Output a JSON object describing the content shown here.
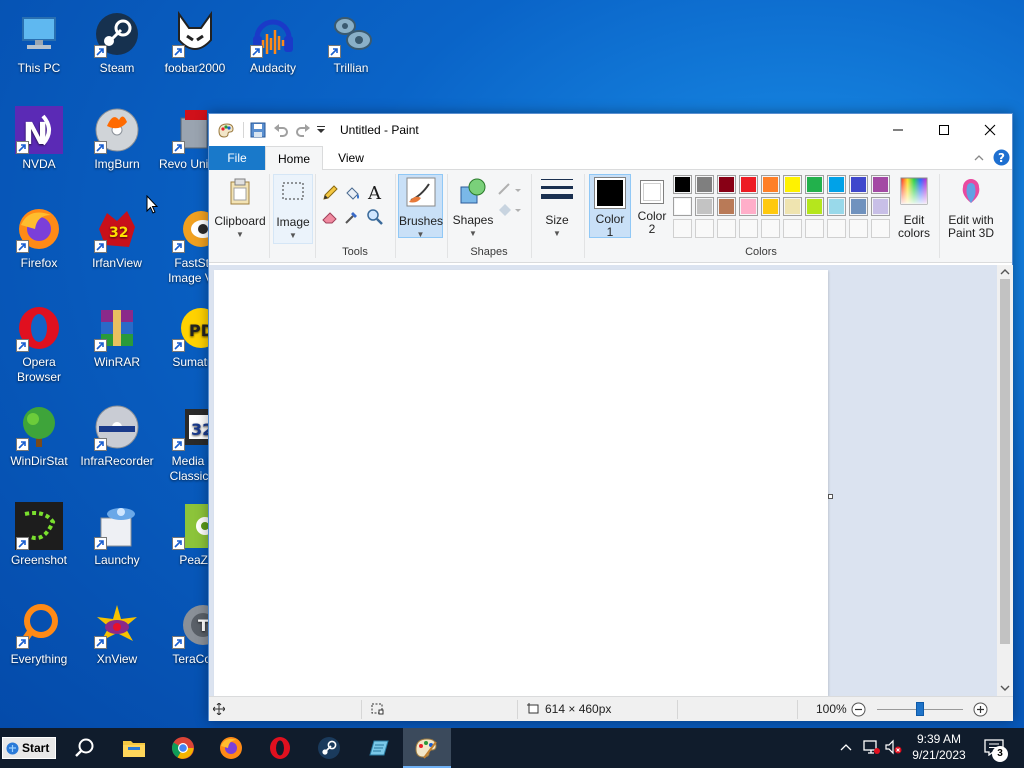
{
  "desktop": {
    "icons": [
      {
        "label": "This PC",
        "icon": "this-pc-icon"
      },
      {
        "label": "Steam",
        "icon": "steam-icon"
      },
      {
        "label": "foobar2000",
        "icon": "foobar2000-icon"
      },
      {
        "label": "Audacity",
        "icon": "audacity-icon"
      },
      {
        "label": "Trillian",
        "icon": "trillian-icon"
      },
      {
        "label": "NVDA",
        "icon": "nvda-icon"
      },
      {
        "label": "ImgBurn",
        "icon": "imgburn-icon"
      },
      {
        "label": "Revo Uninsta",
        "icon": "revo-uninstaller-icon"
      },
      {
        "label": "Firefox",
        "icon": "firefox-icon"
      },
      {
        "label": "IrfanView",
        "icon": "irfanview-icon"
      },
      {
        "label": "FastSto Image Vie",
        "icon": "faststone-icon"
      },
      {
        "label": "Opera Browser",
        "icon": "opera-icon"
      },
      {
        "label": "WinRAR",
        "icon": "winrar-icon"
      },
      {
        "label": "Sumatra",
        "icon": "sumatra-icon"
      },
      {
        "label": "WinDirStat",
        "icon": "windirstat-icon"
      },
      {
        "label": "InfraRecorder",
        "icon": "infrarecorder-icon"
      },
      {
        "label": "Media Pl Classic H",
        "icon": "mpc-hc-icon"
      },
      {
        "label": "Greenshot",
        "icon": "greenshot-icon"
      },
      {
        "label": "Launchy",
        "icon": "launchy-icon"
      },
      {
        "label": "PeaZi",
        "icon": "peazip-icon"
      },
      {
        "label": "Everything",
        "icon": "everything-icon"
      },
      {
        "label": "XnView",
        "icon": "xnview-icon"
      },
      {
        "label": "TeraCop",
        "icon": "teracopy-icon"
      }
    ]
  },
  "paint": {
    "title": "Untitled - Paint",
    "tabs": {
      "file": "File",
      "home": "Home",
      "view": "View"
    },
    "ribbon": {
      "clipboard": "Clipboard",
      "image": "Image",
      "tools_group": "Tools",
      "brushes": "Brushes",
      "shapes": "Shapes",
      "shapes_group": "Shapes",
      "size": "Size",
      "color1": "Color 1",
      "color1_line1": "Color",
      "color1_line2": "1",
      "color2_line1": "Color",
      "color2_line2": "2",
      "colors_group": "Colors",
      "edit_colors_line1": "Edit",
      "edit_colors_line2": "colors",
      "edit_3d_line1": "Edit with",
      "edit_3d_line2": "Paint 3D"
    },
    "palette_row1": [
      "#000000",
      "#7f7f7f",
      "#880015",
      "#ed1c24",
      "#ff7f27",
      "#fff200",
      "#22b14c",
      "#00a2e8",
      "#3f48cc",
      "#a349a4"
    ],
    "palette_row2": [
      "#ffffff",
      "#c3c3c3",
      "#b97a57",
      "#ffaec9",
      "#ffc90e",
      "#efe4b0",
      "#b5e61d",
      "#99d9ea",
      "#7092be",
      "#c8bfe7"
    ],
    "color1_value": "#000000",
    "color2_value": "#ffffff",
    "status": {
      "canvas_size": "614 × 460px",
      "zoom": "100%",
      "zoom_level": 1.0
    }
  },
  "taskbar": {
    "start_label": "Start",
    "time": "9:39 AM",
    "date": "9/21/2023",
    "notification_count": "3",
    "apps": [
      "search-icon",
      "file-explorer-icon",
      "chrome-icon",
      "firefox-icon",
      "opera-icon",
      "steam-icon",
      "notepad-icon",
      "paint-icon"
    ]
  }
}
